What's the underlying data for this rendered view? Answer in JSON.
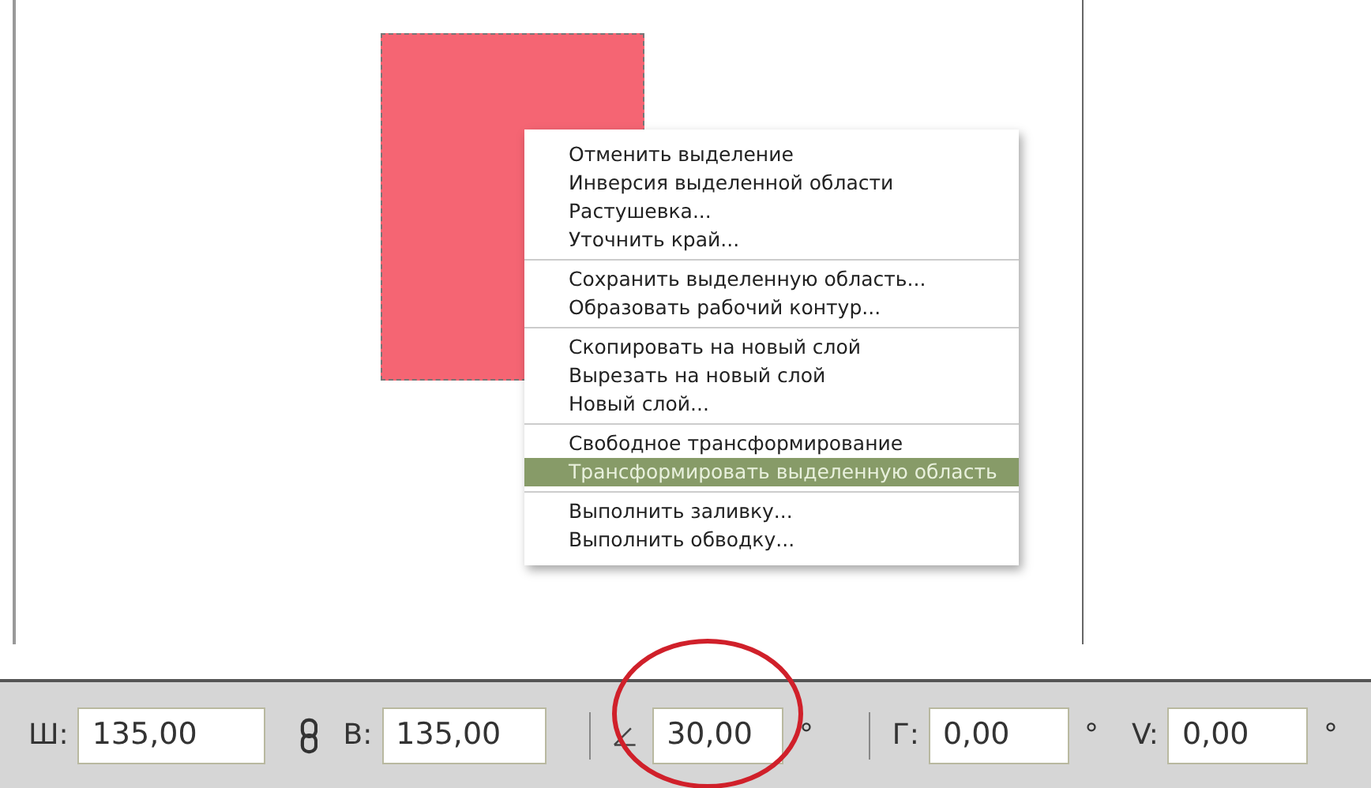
{
  "menu": {
    "groups": [
      {
        "items": [
          {
            "label": "Отменить выделение",
            "selected": false
          },
          {
            "label": "Инверсия выделенной области",
            "selected": false
          },
          {
            "label": "Растушевка...",
            "selected": false
          },
          {
            "label": "Уточнить край...",
            "selected": false
          }
        ]
      },
      {
        "items": [
          {
            "label": "Сохранить выделенную область...",
            "selected": false
          },
          {
            "label": "Образовать рабочий контур...",
            "selected": false
          }
        ]
      },
      {
        "items": [
          {
            "label": "Скопировать на новый слой",
            "selected": false
          },
          {
            "label": "Вырезать на новый слой",
            "selected": false
          },
          {
            "label": "Новый слой...",
            "selected": false
          }
        ]
      },
      {
        "items": [
          {
            "label": "Свободное трансформирование",
            "selected": false
          },
          {
            "label": "Трансформировать выделенную область",
            "selected": true
          }
        ]
      },
      {
        "items": [
          {
            "label": "Выполнить заливку...",
            "selected": false
          },
          {
            "label": "Выполнить обводку...",
            "selected": false
          }
        ]
      }
    ]
  },
  "toolbar": [
    {
      "kind": "field",
      "label": "Ш:",
      "value": "135,00"
    },
    {
      "kind": "link"
    },
    {
      "kind": "field",
      "label": "В:",
      "value": "135,00"
    },
    {
      "kind": "divider"
    },
    {
      "kind": "angle"
    },
    {
      "kind": "field",
      "value": "30,00",
      "unit": "°",
      "highlighted": true
    },
    {
      "kind": "divider"
    },
    {
      "kind": "field",
      "label": "Г:",
      "value": "0,00",
      "unit": "°"
    },
    {
      "kind": "field",
      "label": "V:",
      "value": "0,00",
      "unit": "°"
    }
  ]
}
